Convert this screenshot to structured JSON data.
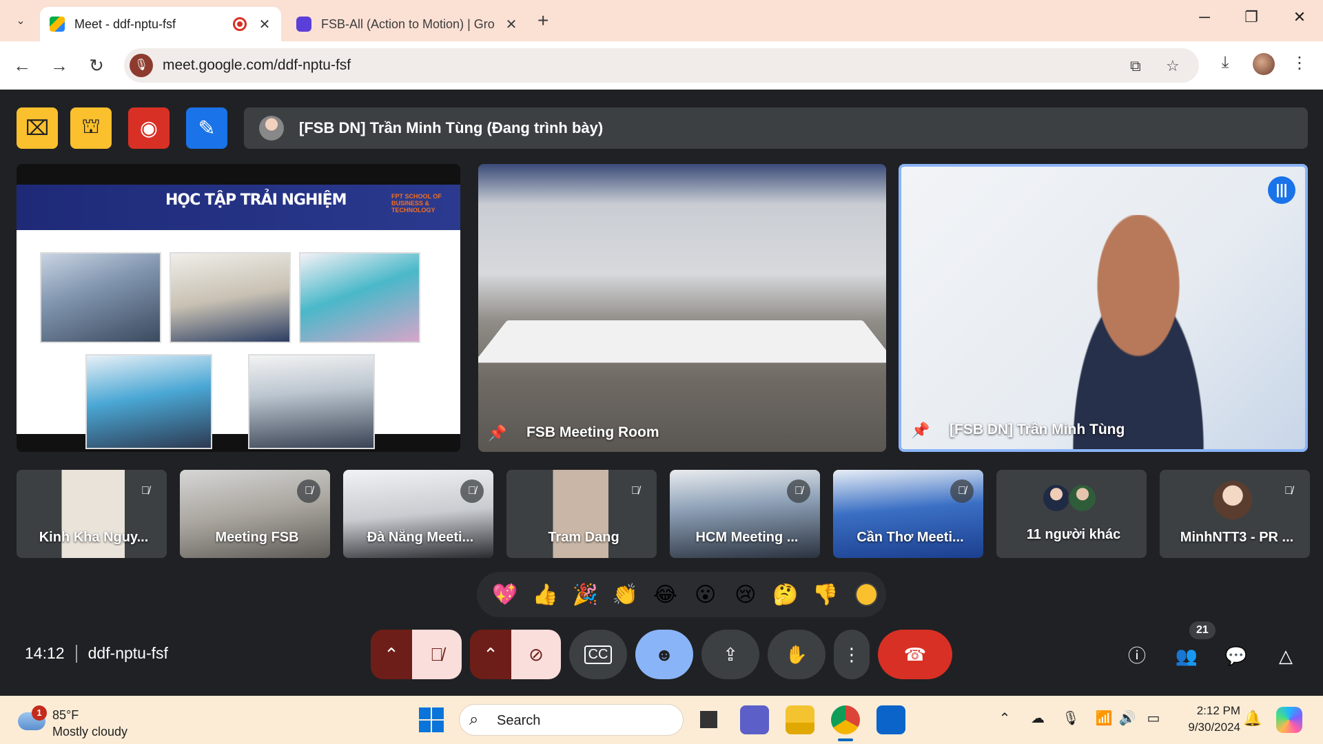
{
  "browser": {
    "tabs": [
      {
        "title": "Meet - ddf-nptu-fsf",
        "active": true
      },
      {
        "title": "FSB-All (Action to Motion) | Gro",
        "active": false
      }
    ],
    "url": "meet.google.com/ddf-nptu-fsf"
  },
  "meet": {
    "presenter_banner": "[FSB DN] Trần Minh Tùng (Đang trình bày)",
    "slide_title": "HỌC TẬP TRẢI NGHIỆM",
    "slide_logo_text": "FPT SCHOOL OF BUSINESS & TECHNOLOGY",
    "main_tiles": [
      {
        "name": "FSB Meeting Room"
      },
      {
        "name": "[FSB DN] Trần Minh Tùng"
      }
    ],
    "participants": [
      {
        "name": "Kinh Kha Nguy..."
      },
      {
        "name": "Meeting FSB"
      },
      {
        "name": "Đà Nẵng Meeti..."
      },
      {
        "name": "Tram Dang"
      },
      {
        "name": "HCM Meeting ..."
      },
      {
        "name": "Cần Thơ Meeti..."
      },
      {
        "name": "11 người khác"
      },
      {
        "name": "MinhNTT3 - PR ..."
      }
    ],
    "reactions": [
      "💖",
      "👍",
      "🎉",
      "👏",
      "😂",
      "😮",
      "😢",
      "🤔",
      "👎"
    ],
    "time": "14:12",
    "meeting_code": "ddf-nptu-fsf",
    "people_count": "21",
    "colors": {
      "leave": "#d93025",
      "active_blue": "#8ab4f8",
      "mic_off_bg": "#f9dedc"
    }
  },
  "taskbar": {
    "weather_badge": "1",
    "temperature": "85°F",
    "condition": "Mostly cloudy",
    "search_placeholder": "Search",
    "time": "2:12 PM",
    "date": "9/30/2024"
  }
}
